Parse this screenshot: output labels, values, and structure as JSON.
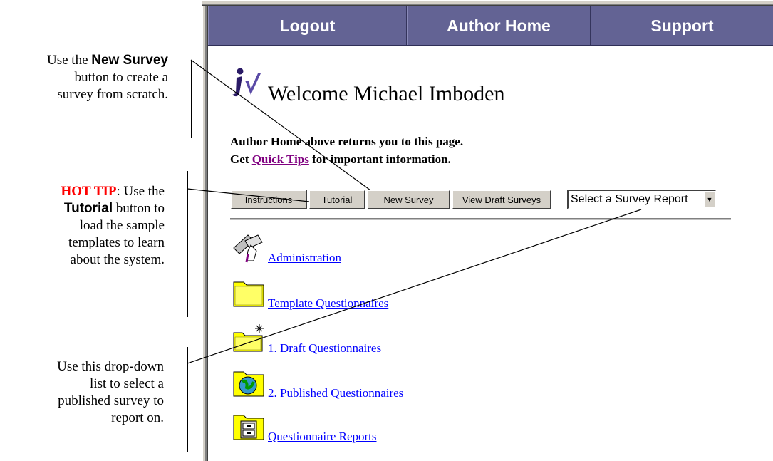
{
  "callouts": {
    "new_survey": {
      "line1_pre": "Use the ",
      "line1_bold": "New Survey",
      "line2": "button to create a",
      "line3": "survey from scratch."
    },
    "hot_tip": {
      "hot": "HOT TIP",
      "line1_post": ": Use the",
      "line2_bold": "Tutorial",
      "line2_post": " button to",
      "line3": "load the sample",
      "line4": "templates to learn",
      "line5": "about the system."
    },
    "dropdown": {
      "line1": "Use this drop-down",
      "line2": "list to select a",
      "line3": "published survey to",
      "line4": "report on."
    }
  },
  "nav": {
    "logout": "Logout",
    "author_home": "Author Home",
    "support": "Support"
  },
  "welcome": "Welcome Michael Imboden",
  "info": {
    "line1": "Author Home above returns you to this page.",
    "line2_pre": "Get ",
    "line2_link": "Quick Tips",
    "line2_post": " for important information."
  },
  "buttons": {
    "instructions": "Instructions",
    "tutorial": "Tutorial",
    "new_survey": "New Survey",
    "view_drafts": "View Draft Surveys"
  },
  "report_select": {
    "selected": "Select a Survey Report"
  },
  "folders": [
    {
      "label": "Administration",
      "icon": "administration-icon"
    },
    {
      "label": "Template Questionnaires",
      "icon": "folder-icon"
    },
    {
      "label": "1. Draft Questionnaires",
      "icon": "new-folder-icon"
    },
    {
      "label": "2. Published Questionnaires",
      "icon": "globe-folder-icon"
    },
    {
      "label": "Questionnaire Reports",
      "icon": "cabinet-folder-icon"
    }
  ],
  "colors": {
    "navbar": "#636394",
    "hot_tip": "#ff0000",
    "link": "#0000ff",
    "visited_link": "#800080",
    "folder_yellow": "#ffff00"
  }
}
